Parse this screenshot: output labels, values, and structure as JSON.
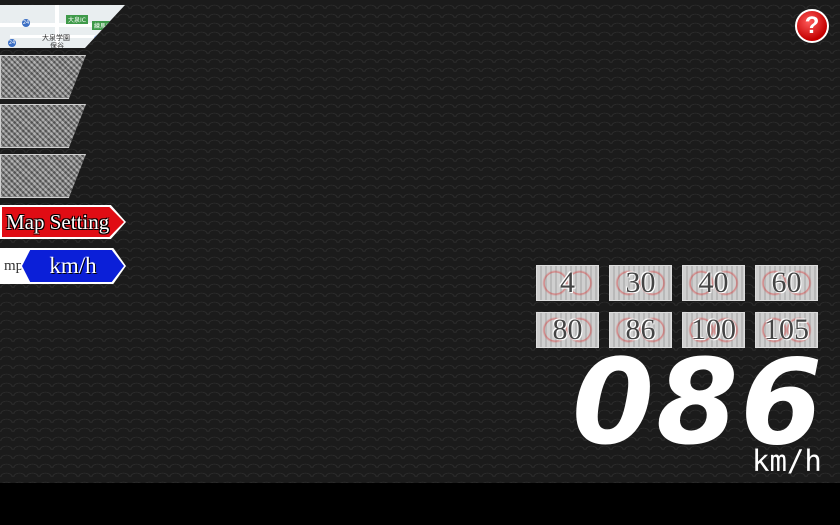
{
  "sidebar": {
    "map_thumbnail": {
      "labels": [
        "大泉IC",
        "練馬IC",
        "大泉学園",
        "24",
        "24",
        "24",
        "保谷"
      ]
    },
    "map_setting_label": "Map Setting",
    "unit_inactive_label": "mph",
    "unit_active_label": "km/h"
  },
  "help": {
    "icon": "question-icon",
    "label": "?"
  },
  "speed_limits": [
    "4",
    "30",
    "40",
    "60",
    "80",
    "86",
    "100",
    "105"
  ],
  "speedometer": {
    "value": "086",
    "unit": "km/h"
  },
  "colors": {
    "map_setting": "#e00c14",
    "unit_active": "#0b1fd8",
    "help": "#d40000"
  }
}
